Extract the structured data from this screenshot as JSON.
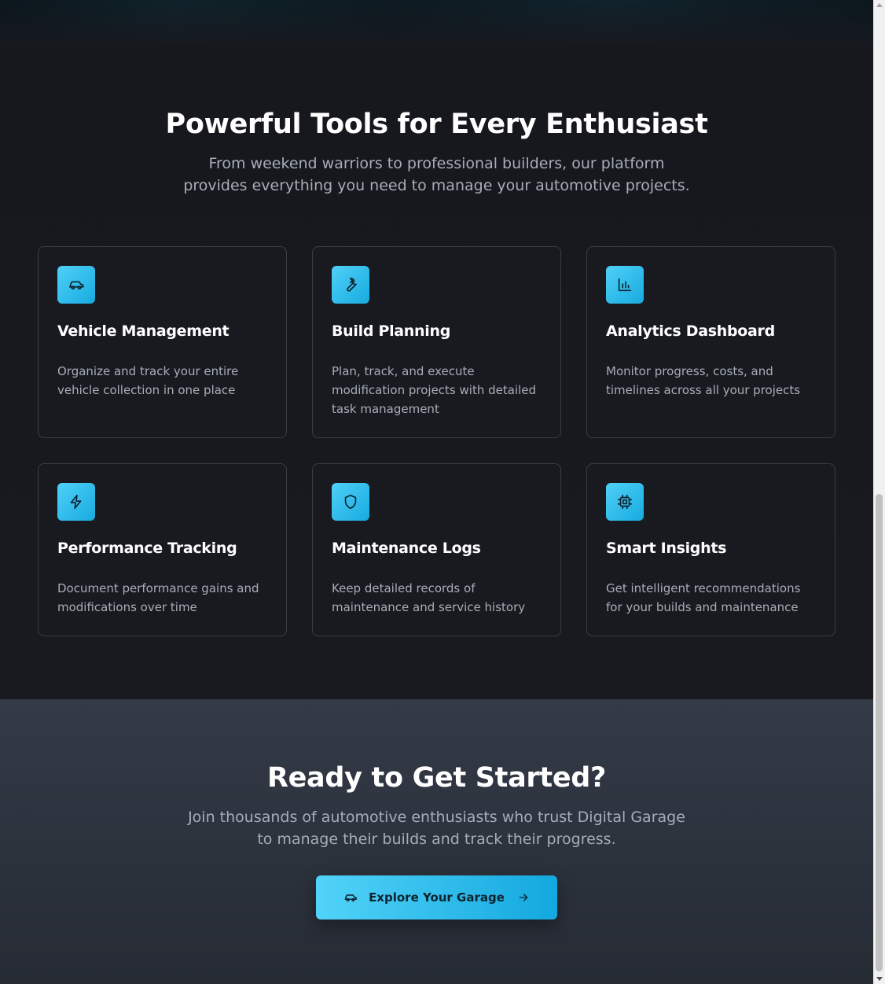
{
  "features": {
    "title": "Powerful Tools for Every Enthusiast",
    "subtitle": "From weekend warriors to professional builders, our platform provides everything you need to manage your automotive projects.",
    "cards": [
      {
        "icon": "car-icon",
        "title": "Vehicle Management",
        "description": "Organize and track your entire vehicle collection in one place"
      },
      {
        "icon": "wrench-icon",
        "title": "Build Planning",
        "description": "Plan, track, and execute modification projects with detailed task management"
      },
      {
        "icon": "bar-chart-icon",
        "title": "Analytics Dashboard",
        "description": "Monitor progress, costs, and timelines across all your projects"
      },
      {
        "icon": "lightning-icon",
        "title": "Performance Tracking",
        "description": "Document performance gains and modifications over time"
      },
      {
        "icon": "shield-icon",
        "title": "Maintenance Logs",
        "description": "Keep detailed records of maintenance and service history"
      },
      {
        "icon": "cpu-icon",
        "title": "Smart Insights",
        "description": "Get intelligent recommendations for your builds and maintenance"
      }
    ]
  },
  "cta": {
    "title": "Ready to Get Started?",
    "subtitle": "Join thousands of automotive enthusiasts who trust Digital Garage to manage their builds and track their progress.",
    "button_label": "Explore Your Garage",
    "button_icon": "car-icon",
    "button_arrow": "arrow-right-icon"
  },
  "colors": {
    "accent_start": "#4fd0f7",
    "accent_end": "#13a8df",
    "background": "#17191f",
    "cta_background": "#333b47"
  }
}
